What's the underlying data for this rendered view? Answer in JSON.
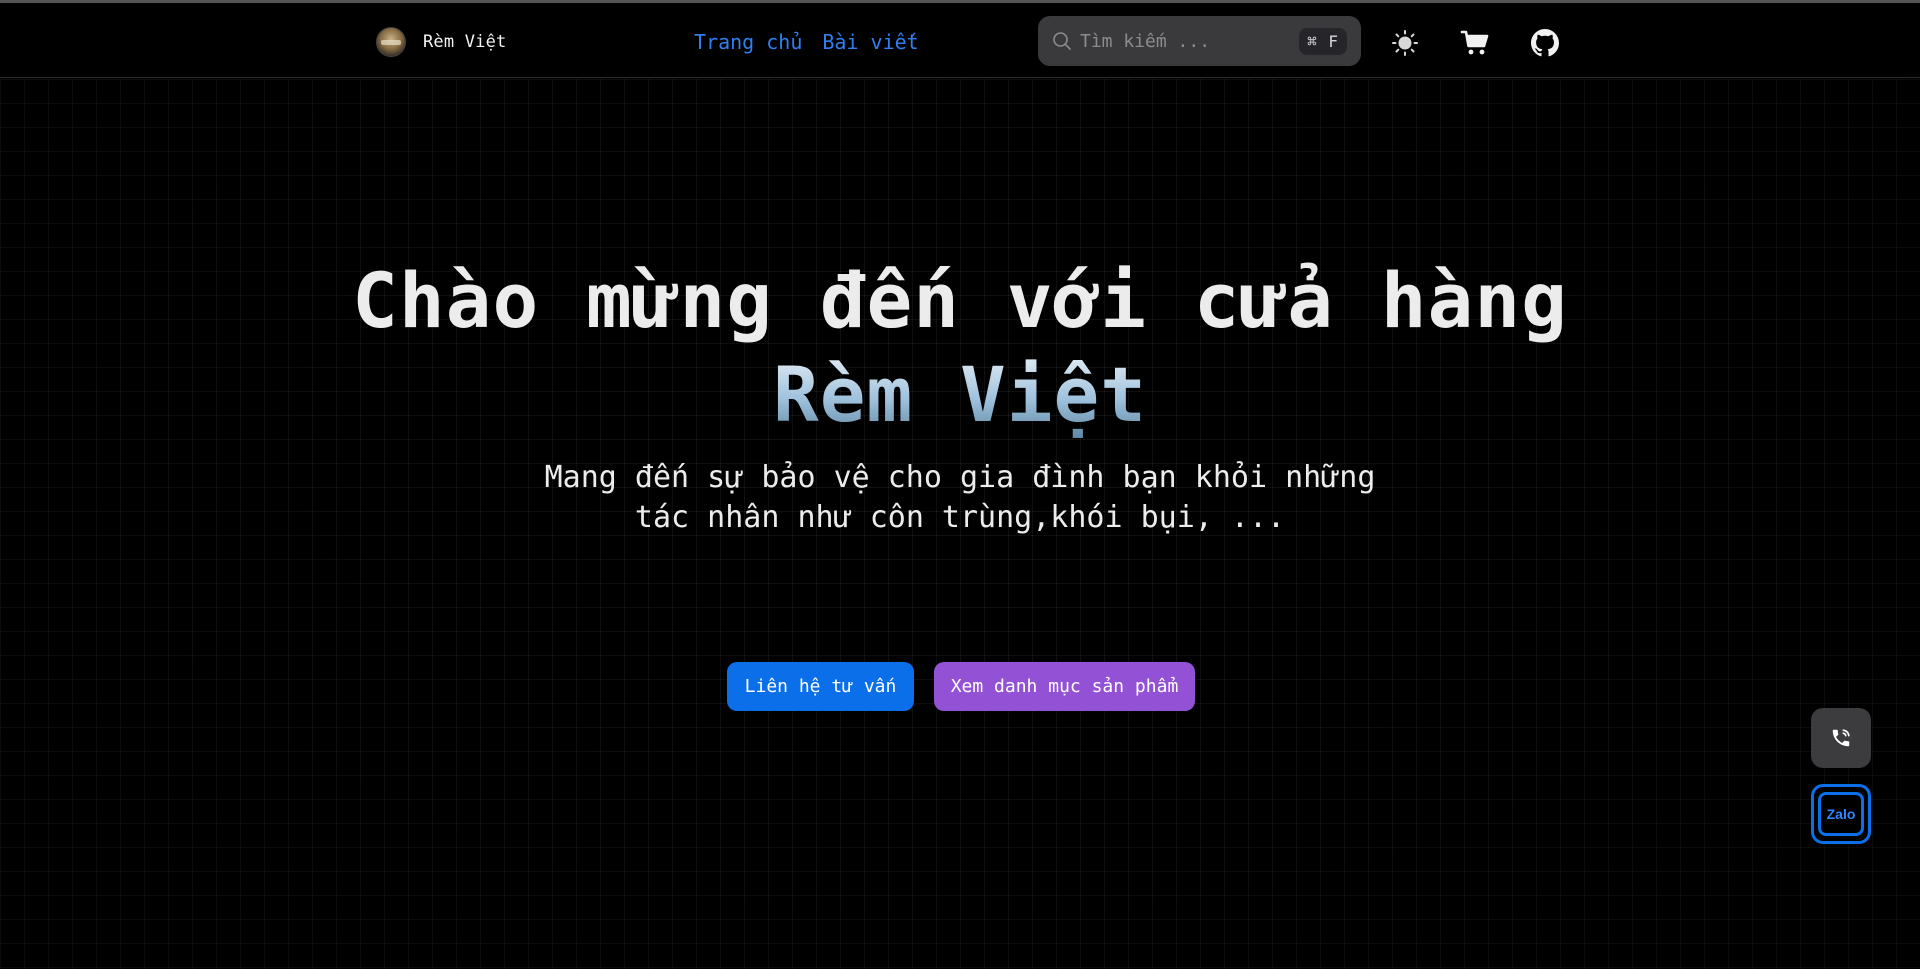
{
  "navbar": {
    "brand_name": "Rèm Việt",
    "links": [
      "Trang chủ",
      "Bài viết"
    ],
    "search_placeholder": "Tìm kiếm ...",
    "search_shortcut": "⌘ F"
  },
  "hero": {
    "title_line1": "Chào mừng đến với cửa hàng",
    "title_brand": "Rèm Việt",
    "subtitle_line1": "Mang đến sự bảo vệ cho gia đình bạn khỏi những",
    "subtitle_line2": "tác nhân như côn trùng,khói bụi, ...",
    "primary_button": "Liên hệ tư vấn",
    "secondary_button": "Xem danh mục sản phẩm"
  },
  "floating": {
    "zalo_label": "Zalo"
  },
  "icons": {
    "theme": "sun-icon",
    "cart": "cart-icon",
    "github": "github-icon",
    "phone": "phone-icon",
    "zalo": "zalo-icon",
    "search": "search-icon"
  },
  "colors": {
    "link": "#2f7ff0",
    "primary": "#0a6fe8",
    "secondary": "#9352d6",
    "background": "#000000"
  }
}
